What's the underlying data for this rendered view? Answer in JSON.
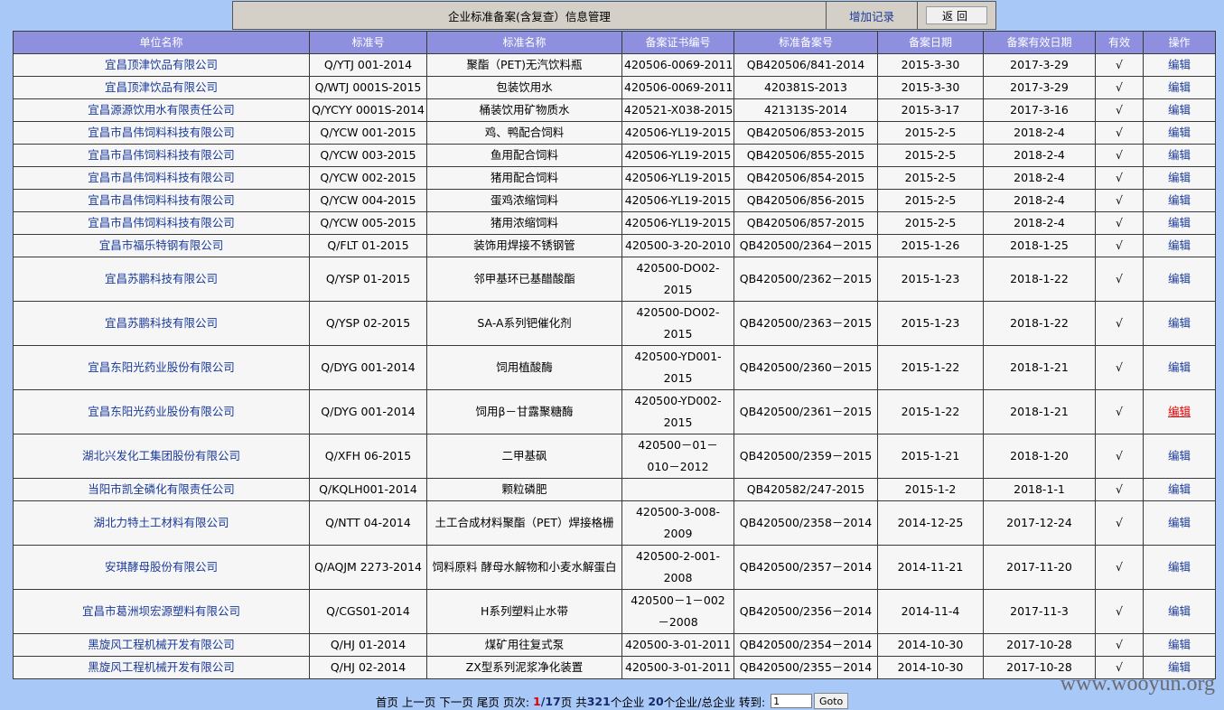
{
  "header": {
    "title": "企业标准备案(含复查）信息管理",
    "add_label": "增加记录",
    "back_label": "返回"
  },
  "table": {
    "columns": [
      "单位名称",
      "标准号",
      "标准名称",
      "备案证书编号",
      "标准备案号",
      "备案日期",
      "备案有效日期",
      "有效",
      "操作"
    ],
    "rows": [
      {
        "unit": "宜昌顶津饮品有限公司",
        "std_no": "Q/YTJ 001-2014",
        "std_name": "聚酯（PET)无汽饮料瓶",
        "cert_no": "420506-0069-2011",
        "record_no": "QB420506/841-2014",
        "date": "2015-3-30",
        "valid_date": "2017-3-29",
        "valid": "√",
        "op": "编辑"
      },
      {
        "unit": "宜昌顶津饮品有限公司",
        "std_no": "Q/WTJ 0001S-2015",
        "std_name": "包装饮用水",
        "cert_no": "420506-0069-2011",
        "record_no": "420381S-2013",
        "date": "2015-3-30",
        "valid_date": "2017-3-29",
        "valid": "√",
        "op": "编辑"
      },
      {
        "unit": "宜昌源源饮用水有限责任公司",
        "std_no": "Q/YCYY 0001S-2014",
        "std_name": "桶装饮用矿物质水",
        "cert_no": "420521-X038-2015",
        "record_no": "421313S-2014",
        "date": "2015-3-17",
        "valid_date": "2017-3-16",
        "valid": "√",
        "op": "编辑"
      },
      {
        "unit": "宜昌市昌伟饲料科技有限公司",
        "std_no": "Q/YCW 001-2015",
        "std_name": "鸡、鸭配合饲料",
        "cert_no": "420506-YL19-2015",
        "record_no": "QB420506/853-2015",
        "date": "2015-2-5",
        "valid_date": "2018-2-4",
        "valid": "√",
        "op": "编辑"
      },
      {
        "unit": "宜昌市昌伟饲料科技有限公司",
        "std_no": "Q/YCW 003-2015",
        "std_name": "鱼用配合饲料",
        "cert_no": "420506-YL19-2015",
        "record_no": "QB420506/855-2015",
        "date": "2015-2-5",
        "valid_date": "2018-2-4",
        "valid": "√",
        "op": "编辑"
      },
      {
        "unit": "宜昌市昌伟饲料科技有限公司",
        "std_no": "Q/YCW 002-2015",
        "std_name": "猪用配合饲料",
        "cert_no": "420506-YL19-2015",
        "record_no": "QB420506/854-2015",
        "date": "2015-2-5",
        "valid_date": "2018-2-4",
        "valid": "√",
        "op": "编辑"
      },
      {
        "unit": "宜昌市昌伟饲料科技有限公司",
        "std_no": "Q/YCW 004-2015",
        "std_name": "蛋鸡浓缩饲料",
        "cert_no": "420506-YL19-2015",
        "record_no": "QB420506/856-2015",
        "date": "2015-2-5",
        "valid_date": "2018-2-4",
        "valid": "√",
        "op": "编辑"
      },
      {
        "unit": "宜昌市昌伟饲料科技有限公司",
        "std_no": "Q/YCW 005-2015",
        "std_name": "猪用浓缩饲料",
        "cert_no": "420506-YL19-2015",
        "record_no": "QB420506/857-2015",
        "date": "2015-2-5",
        "valid_date": "2018-2-4",
        "valid": "√",
        "op": "编辑"
      },
      {
        "unit": "宜昌市福乐特钢有限公司",
        "std_no": "Q/FLT 01-2015",
        "std_name": "装饰用焊接不锈钢管",
        "cert_no": "420500-3-20-2010",
        "record_no": "QB420500/2364－2015",
        "date": "2015-1-26",
        "valid_date": "2018-1-25",
        "valid": "√",
        "op": "编辑"
      },
      {
        "unit": "宜昌苏鹏科技有限公司",
        "std_no": "Q/YSP 01-2015",
        "std_name": "邻甲基环已基醋酸酯",
        "cert_no": "420500-DO02-2015",
        "record_no": "QB420500/2362－2015",
        "date": "2015-1-23",
        "valid_date": "2018-1-22",
        "valid": "√",
        "op": "编辑"
      },
      {
        "unit": "宜昌苏鹏科技有限公司",
        "std_no": "Q/YSP 02-2015",
        "std_name": "SA-A系列钯催化剂",
        "cert_no": "420500-DO02-2015",
        "record_no": "QB420500/2363－2015",
        "date": "2015-1-23",
        "valid_date": "2018-1-22",
        "valid": "√",
        "op": "编辑"
      },
      {
        "unit": "宜昌东阳光药业股份有限公司",
        "std_no": "Q/DYG 001-2014",
        "std_name": "饲用植酸酶",
        "cert_no": "420500-YD001-2015",
        "record_no": "QB420500/2360－2015",
        "date": "2015-1-22",
        "valid_date": "2018-1-21",
        "valid": "√",
        "op": "编辑"
      },
      {
        "unit": "宜昌东阳光药业股份有限公司",
        "std_no": "Q/DYG 001-2014",
        "std_name": "饲用β－甘露聚糖酶",
        "cert_no": "420500-YD002-2015",
        "record_no": "QB420500/2361－2015",
        "date": "2015-1-22",
        "valid_date": "2018-1-21",
        "valid": "√",
        "op": "编辑"
      },
      {
        "unit": "湖北兴发化工集团股份有限公司",
        "std_no": "Q/XFH 06-2015",
        "std_name": "二甲基砜",
        "cert_no": "420500－01－010－2012",
        "record_no": "QB420500/2359－2015",
        "date": "2015-1-21",
        "valid_date": "2018-1-20",
        "valid": "√",
        "op": "编辑"
      },
      {
        "unit": "当阳市凯全磷化有限责任公司",
        "std_no": "Q/KQLH001-2014",
        "std_name": "颗粒磷肥",
        "cert_no": "",
        "record_no": "QB420582/247-2015",
        "date": "2015-1-2",
        "valid_date": "2018-1-1",
        "valid": "√",
        "op": "编辑"
      },
      {
        "unit": "湖北力特土工材料有限公司",
        "std_no": "Q/NTT 04-2014",
        "std_name": "土工合成材料聚酯（PET）焊接格栅",
        "cert_no": "420500-3-008-2009",
        "record_no": "QB420500/2358－2014",
        "date": "2014-12-25",
        "valid_date": "2017-12-24",
        "valid": "√",
        "op": "编辑"
      },
      {
        "unit": "安琪酵母股份有限公司",
        "std_no": "Q/AQJM 2273-2014",
        "std_name": "饲料原料 酵母水解物和小麦水解蛋白",
        "cert_no": "420500-2-001-2008",
        "record_no": "QB420500/2357－2014",
        "date": "2014-11-21",
        "valid_date": "2017-11-20",
        "valid": "√",
        "op": "编辑"
      },
      {
        "unit": "宜昌市葛洲坝宏源塑料有限公司",
        "std_no": "Q/CGS01-2014",
        "std_name": "H系列塑料止水带",
        "cert_no": "420500－1－002－2008",
        "record_no": "QB420500/2356－2014",
        "date": "2014-11-4",
        "valid_date": "2017-11-3",
        "valid": "√",
        "op": "编辑"
      },
      {
        "unit": "黑旋风工程机械开发有限公司",
        "std_no": "Q/HJ 01-2014",
        "std_name": "煤矿用往复式泵",
        "cert_no": "420500-3-01-2011",
        "record_no": "QB420500/2354－2014",
        "date": "2014-10-30",
        "valid_date": "2017-10-28",
        "valid": "√",
        "op": "编辑"
      },
      {
        "unit": "黑旋风工程机械开发有限公司",
        "std_no": "Q/HJ 02-2014",
        "std_name": "ZX型系列泥浆净化装置",
        "cert_no": "420500-3-01-2011",
        "record_no": "QB420500/2355－2014",
        "date": "2014-10-30",
        "valid_date": "2017-10-28",
        "valid": "√",
        "op": "编辑"
      }
    ]
  },
  "pagination": {
    "first": "首页",
    "prev": "上一页",
    "next": "下一页",
    "last": "尾页",
    "page_label": "页次:",
    "current_page": "1",
    "total_pages": "/17",
    "page_suffix": "页",
    "total_prefix": "共",
    "total_count": "321",
    "total_suffix": "个企业",
    "per_page": "20",
    "per_page_suffix": "个企业/总企业",
    "goto_label": "转到:",
    "goto_value": "1",
    "goto_button": "Goto"
  },
  "watermark": "www.wooyun.org"
}
